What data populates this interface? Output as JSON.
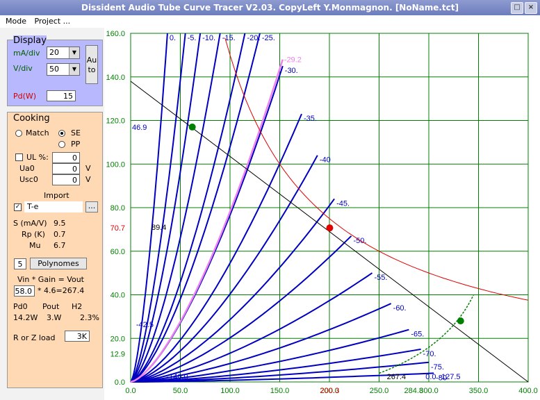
{
  "window": {
    "title": "Dissident Audio Tube Curve Tracer V2.03. CopyLeft Y.Monmagnon. [NoName.tct]"
  },
  "menu": [
    "Mode",
    "Project ..."
  ],
  "display": {
    "title": "Display",
    "ma_div_label": "mA/div",
    "ma_div_value": "20",
    "v_div_label": "V/div",
    "v_div_value": "50",
    "auto_label": "Au to",
    "pd_label": "Pd(W)",
    "pd_value": "15"
  },
  "cooking": {
    "title": "Cooking",
    "match_label": "Match",
    "se_label": "SE",
    "pp_label": "PP",
    "ul_label": "UL  %:",
    "ul_value": "0",
    "ua0_label": "Ua0",
    "ua0_value": "0",
    "ua0_unit": "V",
    "usc0_label": "Usc0",
    "usc0_value": "0",
    "usc0_unit": "V",
    "import_label": "Import",
    "te_label": "T-e",
    "browse_label": "...",
    "s_label": "S (mA/V)",
    "s_value": "9.5",
    "rp_label": "Rp (K)",
    "rp_value": "0.7",
    "mu_label": "Mu",
    "mu_value": "6.7",
    "poly_value": "5",
    "poly_button": "Polynomes",
    "vin_gain_label": "Vin   * Gain = Vout",
    "vin_value": "58.0",
    "gain_text": "* 4.6=267.4",
    "pd0_label": "Pd0",
    "pout_label": "Pout",
    "h2_label": "H2",
    "pd0_value": "14.2W",
    "pout_value": "3.W",
    "h2_value": "2.3%",
    "load_label": "R or Z load",
    "load_value": "3",
    "load_unit": "K"
  },
  "colors": {
    "grid": "#008000",
    "curve": "#0000c0",
    "pink": "#ee82ee",
    "red": "#e00000",
    "axis": "#008000"
  },
  "chart_data": {
    "type": "line",
    "xlim": [
      0,
      400
    ],
    "ylim": [
      0,
      160
    ],
    "x_ticks": [
      "0.0",
      "50.0",
      "100.0",
      "150.0",
      "200.0",
      "250.0",
      "300.0",
      "350.0",
      "400.0"
    ],
    "y_ticks": [
      "0.0",
      "20.0",
      "40.0",
      "60.0",
      "80.0",
      "100.0",
      "120.0",
      "140.0",
      "160.0"
    ],
    "curve_labels": [
      "0.",
      "-5.",
      "-10.",
      "-15.",
      "-20.",
      "-25.",
      "-30.",
      "-35.",
      "-40",
      "-45.",
      "-50.",
      "-55.",
      "-60.",
      "-65.",
      "-70.",
      "-75.",
      "-80",
      "-127.5",
      "-140.0",
      "-42.5"
    ],
    "grid_curves": [
      {
        "vg": 0,
        "end": [
          37,
          160
        ]
      },
      {
        "vg": -5,
        "end": [
          55,
          160
        ]
      },
      {
        "vg": -10,
        "end": [
          70,
          160
        ]
      },
      {
        "vg": -15,
        "end": [
          90,
          160
        ]
      },
      {
        "vg": -20,
        "end": [
          115,
          160
        ]
      },
      {
        "vg": -25,
        "end": [
          130,
          160
        ]
      },
      {
        "vg": -30,
        "end": [
          153,
          145
        ]
      },
      {
        "vg": -35,
        "end": [
          172,
          123
        ]
      },
      {
        "vg": -40,
        "end": [
          188,
          104
        ]
      },
      {
        "vg": -45,
        "end": [
          205,
          84
        ]
      },
      {
        "vg": -50,
        "end": [
          222,
          67
        ]
      },
      {
        "vg": -55,
        "end": [
          243,
          50
        ]
      },
      {
        "vg": -60,
        "end": [
          262,
          36
        ]
      },
      {
        "vg": -65,
        "end": [
          280,
          24
        ]
      },
      {
        "vg": -70,
        "end": [
          292,
          15
        ]
      },
      {
        "vg": -75,
        "end": [
          300,
          9
        ]
      },
      {
        "vg": -80,
        "end": [
          305,
          4
        ]
      }
    ],
    "pink_curve": {
      "label": "-29.2",
      "end": [
        153,
        148
      ]
    },
    "load_line": {
      "from": [
        0,
        138
      ],
      "to": [
        400,
        0
      ]
    },
    "pd_hyperbola_w": 15,
    "quiescent": {
      "x": 200.3,
      "y": 70.7,
      "label_x": "200.3",
      "label_y": "70.7"
    },
    "points": [
      {
        "x": 62,
        "y": 117
      },
      {
        "x": 332,
        "y": 28
      }
    ],
    "extra_labels": [
      "46.9",
      "89.4",
      "12.9",
      "267.4",
      "284.8",
      "0.0"
    ]
  }
}
